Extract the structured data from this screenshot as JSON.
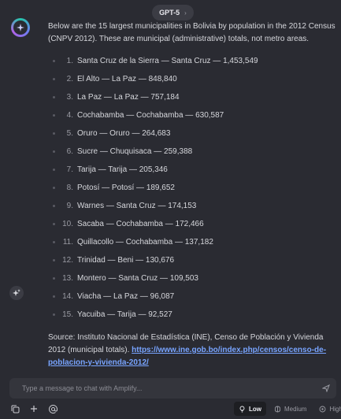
{
  "header": {
    "model": "GPT-5"
  },
  "message": {
    "intro": "Below are the 15 largest municipalities in Bolivia by population in the 2012 Census (CNPV 2012). These are municipal (administrative) totals, not metro areas.",
    "items": [
      {
        "num": "1.",
        "text": "Santa Cruz de la Sierra — Santa Cruz — 1,453,549"
      },
      {
        "num": "2.",
        "text": "El Alto — La Paz — 848,840"
      },
      {
        "num": "3.",
        "text": "La Paz — La Paz — 757,184"
      },
      {
        "num": "4.",
        "text": "Cochabamba — Cochabamba — 630,587"
      },
      {
        "num": "5.",
        "text": "Oruro — Oruro — 264,683"
      },
      {
        "num": "6.",
        "text": "Sucre — Chuquisaca — 259,388"
      },
      {
        "num": "7.",
        "text": "Tarija — Tarija — 205,346"
      },
      {
        "num": "8.",
        "text": "Potosí — Potosí — 189,652"
      },
      {
        "num": "9.",
        "text": "Warnes — Santa Cruz — 174,153"
      },
      {
        "num": "10.",
        "text": "Sacaba — Cochabamba — 172,466"
      },
      {
        "num": "11.",
        "text": "Quillacollo — Cochabamba — 137,182"
      },
      {
        "num": "12.",
        "text": "Trinidad — Beni — 130,676"
      },
      {
        "num": "13.",
        "text": "Montero — Santa Cruz — 109,503"
      },
      {
        "num": "14.",
        "text": "Viacha — La Paz — 96,087"
      },
      {
        "num": "15.",
        "text": "Yacuiba — Tarija — 92,527"
      }
    ],
    "source_text": "Source: Instituto Nacional de Estadística (INE), Censo de Población y Vivienda 2012 (municipal totals).",
    "source_link": "https://www.ine.gob.bo/index.php/censos/censo-de-poblacion-y-vivienda-2012/"
  },
  "input": {
    "placeholder": "Type a message to chat with Amplify..."
  },
  "effort": {
    "low": "Low",
    "medium": "Medium",
    "high": "High"
  },
  "colors": {
    "background": "#2a2b32",
    "link": "#78a4ff",
    "input_bg": "#34353c"
  }
}
